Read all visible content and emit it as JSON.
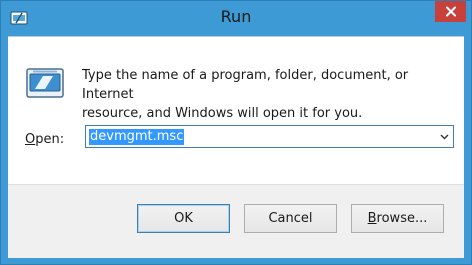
{
  "window": {
    "title": "Run",
    "close_symbol": "✕"
  },
  "dialog": {
    "message_line1": "Type the name of a program, folder, document, or Internet",
    "message_line2": "resource, and Windows will open it for you.",
    "open_label_prefix": "",
    "open_label_underlined": "O",
    "open_label_rest": "pen:",
    "open_value": "devmgmt.msc",
    "dropdown_arrow": "⌄"
  },
  "buttons": {
    "ok": "OK",
    "cancel": "Cancel",
    "browse_underlined": "B",
    "browse_rest": "rowse..."
  },
  "colors": {
    "titlebar": "#3e9ad4",
    "close": "#c7413a",
    "selection": "#3399ff"
  },
  "icons": {
    "app": "run-app-icon",
    "run": "run-dialog-icon",
    "close": "close-icon",
    "dropdown": "chevron-down-icon"
  }
}
